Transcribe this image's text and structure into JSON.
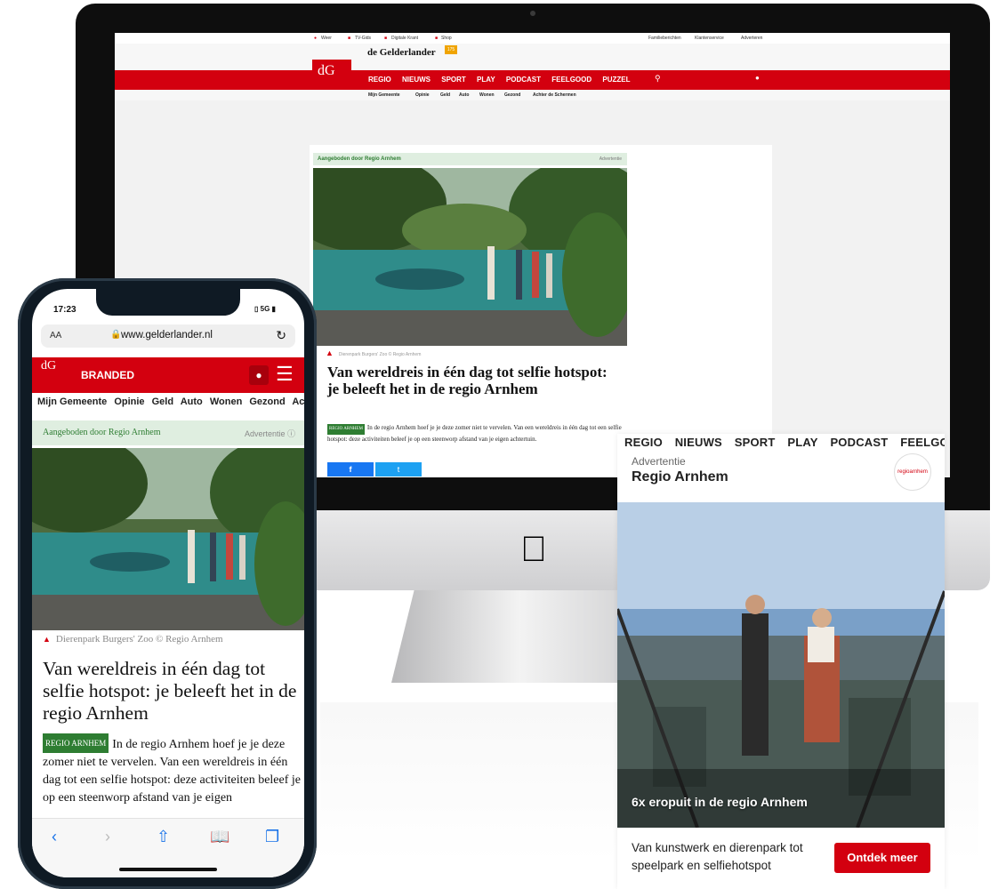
{
  "desktop": {
    "top_links": [
      "Weer",
      "TV-Gids",
      "Digitale Krant",
      "Shop"
    ],
    "right_links": [
      "Familieberichten",
      "Klantenservice",
      "Adverteren"
    ],
    "brand": "de Gelderlander",
    "anniversary": "175",
    "logo_text": "dG",
    "nav": [
      "REGIO",
      "NIEUWS",
      "SPORT",
      "PLAY",
      "PODCAST",
      "FEELGOOD",
      "PUZZEL"
    ],
    "subnav": [
      "Mijn Gemeente",
      "Opinie",
      "Geld",
      "Auto",
      "Wonen",
      "Gezond",
      "Achter de Schermen"
    ],
    "ad_label": "Aangeboden door Regio Arnhem",
    "ad_marker": "Advertentie",
    "caption": "Dierenpark Burgers' Zoo © Regio Arnhem",
    "headline": "Van wereldreis in één dag tot selfie hotspot: je beleeft het in de regio Arnhem",
    "tag": "REGIO ARNHEM",
    "body": "In de regio Arnhem hoef je je deze zomer niet te vervelen. Van een wereldreis in één dag tot een selfie hotspot: deze activiteiten beleef je op een steenworp afstand van je eigen achtertuin.",
    "share_fb": "f",
    "share_tw": "t"
  },
  "adcard": {
    "nav": [
      "REGIO",
      "NIEUWS",
      "SPORT",
      "PLAY",
      "PODCAST",
      "FEELGOOD"
    ],
    "kicker": "Advertentie",
    "title": "Regio Arnhem",
    "badge": "regioarnhem",
    "photo_title": "6x eropuit in de regio Arnhem",
    "description": "Van kunstwerk en dierenpark tot speelpark en selfiehotspot",
    "cta": "Ontdek meer"
  },
  "phone": {
    "time": "17:23",
    "signal": "5G",
    "text_size": "AA",
    "url": "www.gelderlander.nl",
    "logo_text": "dG",
    "section": "BRANDED",
    "subnav": [
      "Mijn Gemeente",
      "Opinie",
      "Geld",
      "Auto",
      "Wonen",
      "Gezond",
      "Achter"
    ],
    "ad_label": "Aangeboden door Regio Arnhem",
    "ad_marker": "Advertentie",
    "caption": "Dierenpark Burgers' Zoo © Regio Arnhem",
    "headline": "Van wereldreis in één dag tot selfie hotspot: je beleeft het in de regio Arnhem",
    "tag": "REGIO ARNHEM",
    "body": "In de regio Arnhem hoef je je deze zomer niet te vervelen. Van een wereldreis in één dag tot een selfie hotspot: deze activiteiten beleef je op een steenworp afstand van je eigen",
    "toolbar_icons": [
      "back-icon",
      "forward-icon",
      "share-icon",
      "bookmarks-icon",
      "tabs-icon"
    ]
  },
  "colors": {
    "brand_red": "#d3000f",
    "ad_green": "#2e7d32",
    "ad_bg": "#dfeee0"
  }
}
